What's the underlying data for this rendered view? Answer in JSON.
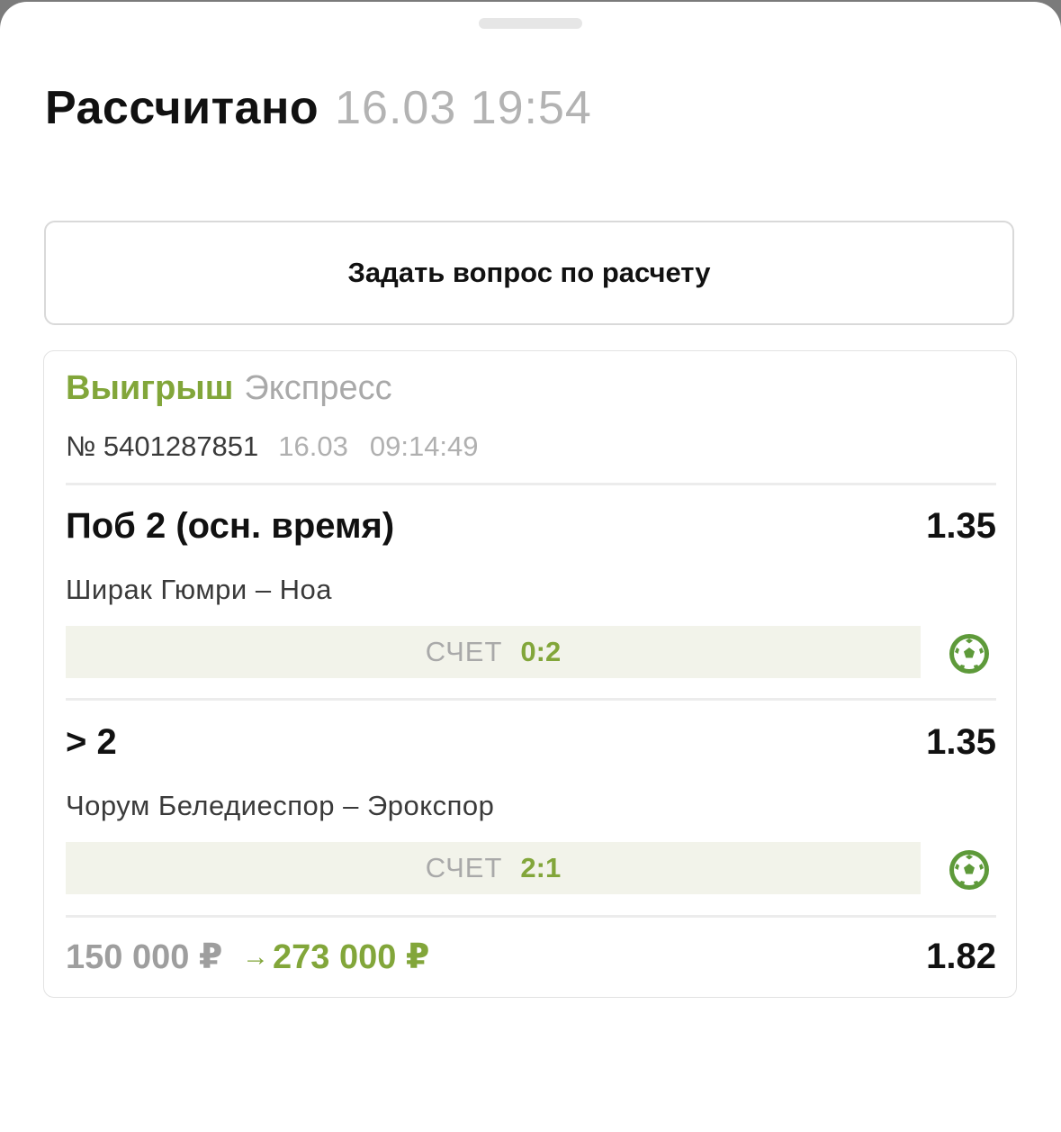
{
  "header": {
    "status": "Рассчитано",
    "datetime": "16.03 19:54"
  },
  "ask_button": {
    "label": "Задать вопрос по расчету"
  },
  "bet": {
    "result": "Выигрыш",
    "type": "Экспресс",
    "number": "№ 5401287851",
    "date": "16.03",
    "time": "09:14:49",
    "events": [
      {
        "market": "Поб 2 (осн. время)",
        "odds": "1.35",
        "teams": "Ширак Гюмри – Ноа",
        "score_label": "СЧЕТ",
        "score_value": "0:2",
        "sport_icon": "soccer-ball-icon"
      },
      {
        "market": "> 2",
        "odds": "1.35",
        "teams": "Чорум Беледиеспор – Эрокспор",
        "score_label": "СЧЕТ",
        "score_value": "2:1",
        "sport_icon": "soccer-ball-icon"
      }
    ],
    "stake": "150 000 ₽",
    "arrow": "→",
    "payout": "273 000 ₽",
    "total_odds": "1.82"
  },
  "colors": {
    "accent_green": "#82a63a",
    "score_bar_bg": "#f2f3ea",
    "muted_text": "#a9a9a9",
    "primary_text": "#111111"
  }
}
